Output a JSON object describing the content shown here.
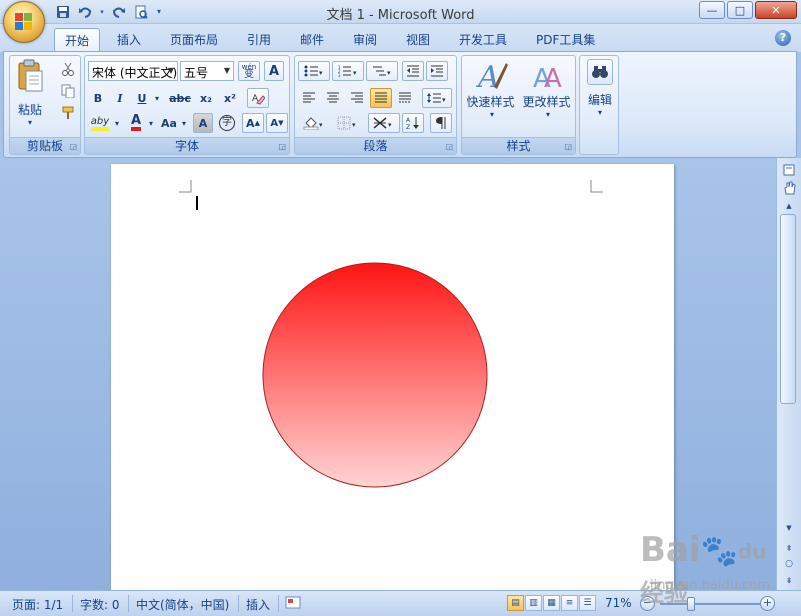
{
  "window": {
    "title": "文档 1 - Microsoft Word"
  },
  "qat": {
    "save": "save-icon",
    "undo": "undo-icon",
    "redo": "redo-icon",
    "print_preview": "print-preview-icon"
  },
  "tabs": [
    "开始",
    "插入",
    "页面布局",
    "引用",
    "邮件",
    "审阅",
    "视图",
    "开发工具",
    "PDF工具集"
  ],
  "help_glyph": "?",
  "clipboard": {
    "paste_label": "粘贴",
    "group_label": "剪贴板"
  },
  "font": {
    "name": "宋体 (中文正文)",
    "size": "五号",
    "wen_glyph": "wén",
    "wen_char": "变",
    "a_box": "A",
    "bold": "B",
    "italic": "I",
    "underline": "U",
    "strike": "abc",
    "sub": "x₂",
    "sup": "x²",
    "highlight": "aby",
    "font_color": "A",
    "case": "Aa",
    "char_shade": "A",
    "enclose": "字",
    "grow": "A",
    "shrink": "A",
    "group_label": "字体"
  },
  "paragraph": {
    "group_label": "段落"
  },
  "styles": {
    "quick_styles": "快速样式",
    "change_styles": "更改样式",
    "group_label": "样式"
  },
  "editing": {
    "label": "编辑"
  },
  "status": {
    "page": "页面: 1/1",
    "words": "字数: 0",
    "language": "中文(简体，中国)",
    "mode": "插入",
    "zoom": "71%"
  },
  "watermark": {
    "main": "Bai",
    "paw": "du",
    "sub_cn": "经验",
    "url": "jingyan.baidu.com"
  },
  "colors": {
    "circle_top": "#ff1414",
    "circle_bottom": "#ffd4d4",
    "circle_stroke": "#b01e1e"
  }
}
